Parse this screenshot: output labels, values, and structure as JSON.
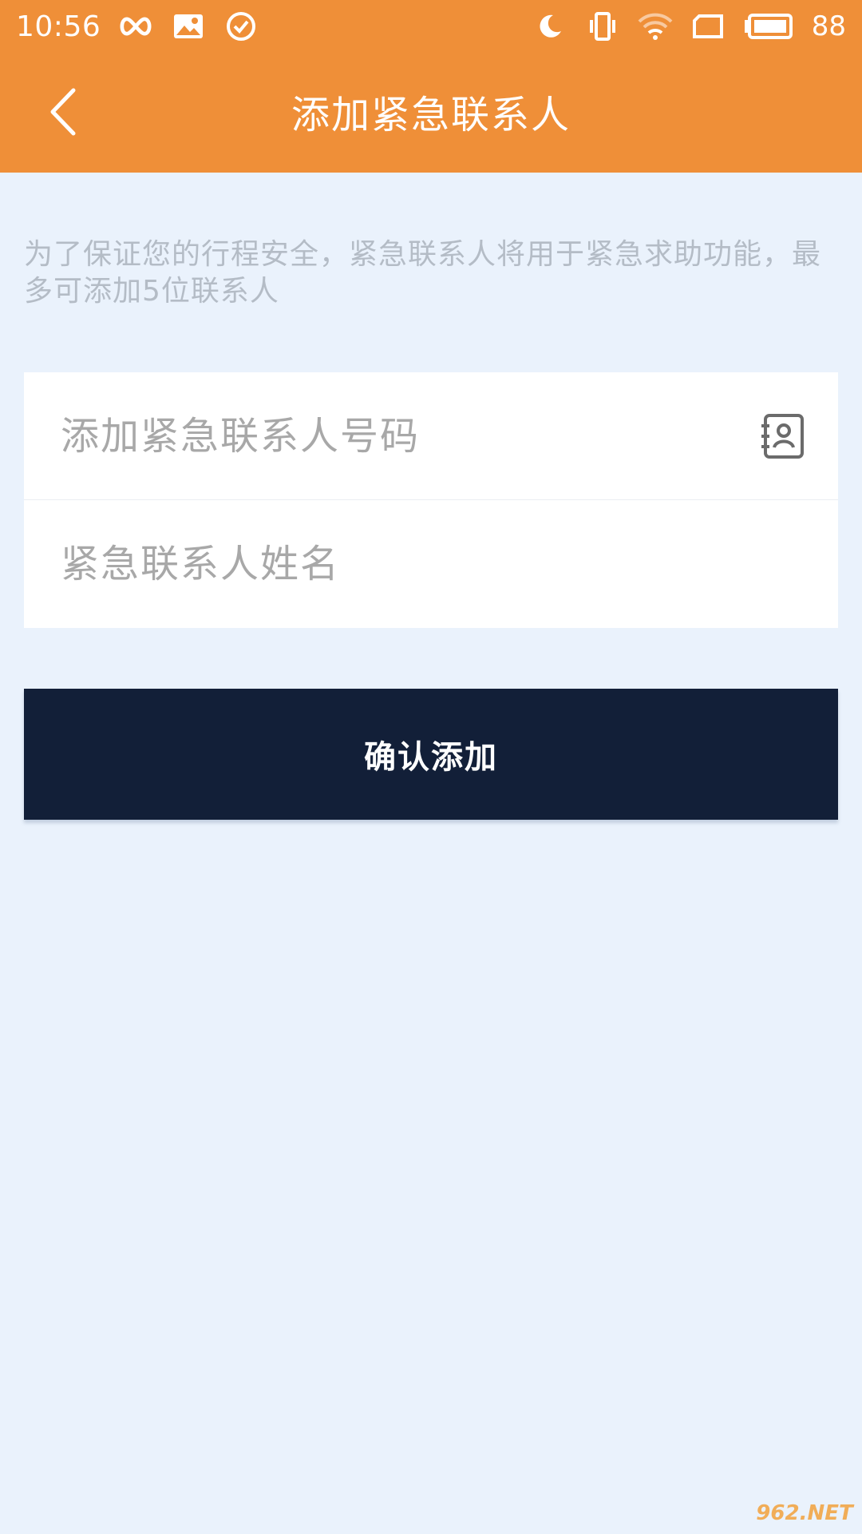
{
  "status_bar": {
    "time": "10:56",
    "battery": "88",
    "left_icons": [
      "infinity-icon",
      "image-icon",
      "check-circle-icon"
    ],
    "right_icons": [
      "moon-icon",
      "vibrate-icon",
      "wifi-icon",
      "tablet-icon",
      "battery-icon"
    ]
  },
  "header": {
    "title": "添加紧急联系人",
    "back_icon": "chevron-left-icon",
    "background": "#ef8f38"
  },
  "notice": "为了保证您的行程安全，紧急联系人将用于紧急求助功能，最多可添加5位联系人",
  "form": {
    "phone_placeholder": "添加紧急联系人号码",
    "phone_value": "",
    "name_placeholder": "紧急联系人姓名",
    "name_value": "",
    "contacts_icon": "contact-book-icon"
  },
  "confirm_button": {
    "label": "确认添加",
    "background": "#121f38"
  },
  "watermark": "962.NET"
}
